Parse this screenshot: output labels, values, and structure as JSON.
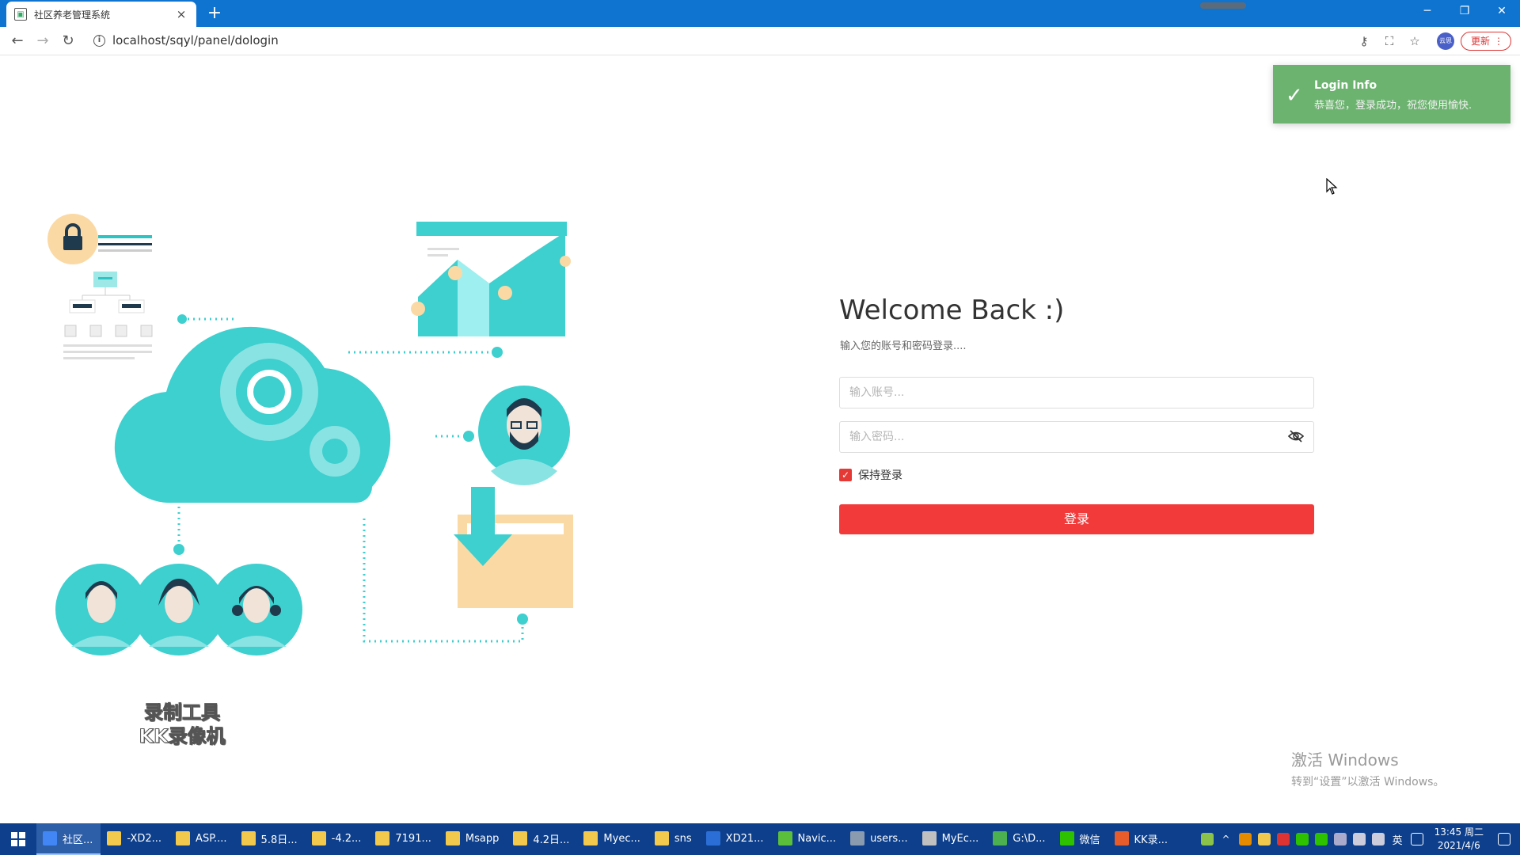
{
  "browser": {
    "tab_title": "社区养老管理系统",
    "tab_close": "×",
    "new_tab": "+",
    "url": "localhost/sqyl/panel/dologin",
    "profile_text": "云思",
    "update_label": "更新",
    "update_menu": "⋮",
    "window_controls": {
      "minimize": "─",
      "restore": "❐",
      "close": "✕"
    },
    "nav": {
      "back": "←",
      "forward": "→",
      "reload": "↻"
    },
    "toolbar_icons": {
      "key": "⚷",
      "translate": "⛶",
      "star": "☆"
    }
  },
  "login": {
    "heading": "Welcome Back :)",
    "subtitle": "输入您的账号和密码登录....",
    "username_placeholder": "输入账号...",
    "password_placeholder": "输入密码...",
    "remember_label": "保持登录",
    "remember_checked": true,
    "submit_label": "登录"
  },
  "toast": {
    "icon": "check-icon",
    "title": "Login Info",
    "message": "恭喜您，登录成功，祝您使用愉快."
  },
  "watermark": {
    "line1": "录制工具",
    "line2": "KK录像机"
  },
  "windows_activation": {
    "line1": "激活 Windows",
    "line2": "转到“设置”以激活 Windows。"
  },
  "taskbar": {
    "items": [
      {
        "label": "社区...",
        "color": "#4285f4",
        "active": true
      },
      {
        "label": "-XD2...",
        "color": "#f2c94c",
        "active": false
      },
      {
        "label": "ASP....",
        "color": "#f2c94c",
        "active": false
      },
      {
        "label": "5.8日...",
        "color": "#f2c94c",
        "active": false
      },
      {
        "label": "-4.2...",
        "color": "#f2c94c",
        "active": false
      },
      {
        "label": "7191...",
        "color": "#f2c94c",
        "active": false
      },
      {
        "label": "Msapp",
        "color": "#f2c94c",
        "active": false
      },
      {
        "label": "4.2日...",
        "color": "#f2c94c",
        "active": false
      },
      {
        "label": "Myec...",
        "color": "#f2c94c",
        "active": false
      },
      {
        "label": "sns",
        "color": "#f2c94c",
        "active": false
      },
      {
        "label": "XD21...",
        "color": "#2b6fd6",
        "active": false
      },
      {
        "label": "Navic...",
        "color": "#5cbf3b",
        "active": false
      },
      {
        "label": "users...",
        "color": "#8a9bb0",
        "active": false
      },
      {
        "label": "MyEc...",
        "color": "#c0c0c0",
        "active": false
      },
      {
        "label": "G:\\D...",
        "color": "#4caf50",
        "active": false
      },
      {
        "label": "微信",
        "color": "#2dc100",
        "active": false
      },
      {
        "label": "KK录...",
        "color": "#e65c2a",
        "active": false
      }
    ],
    "ime": "英",
    "time": "13:45 周二",
    "date": "2021/4/6"
  }
}
